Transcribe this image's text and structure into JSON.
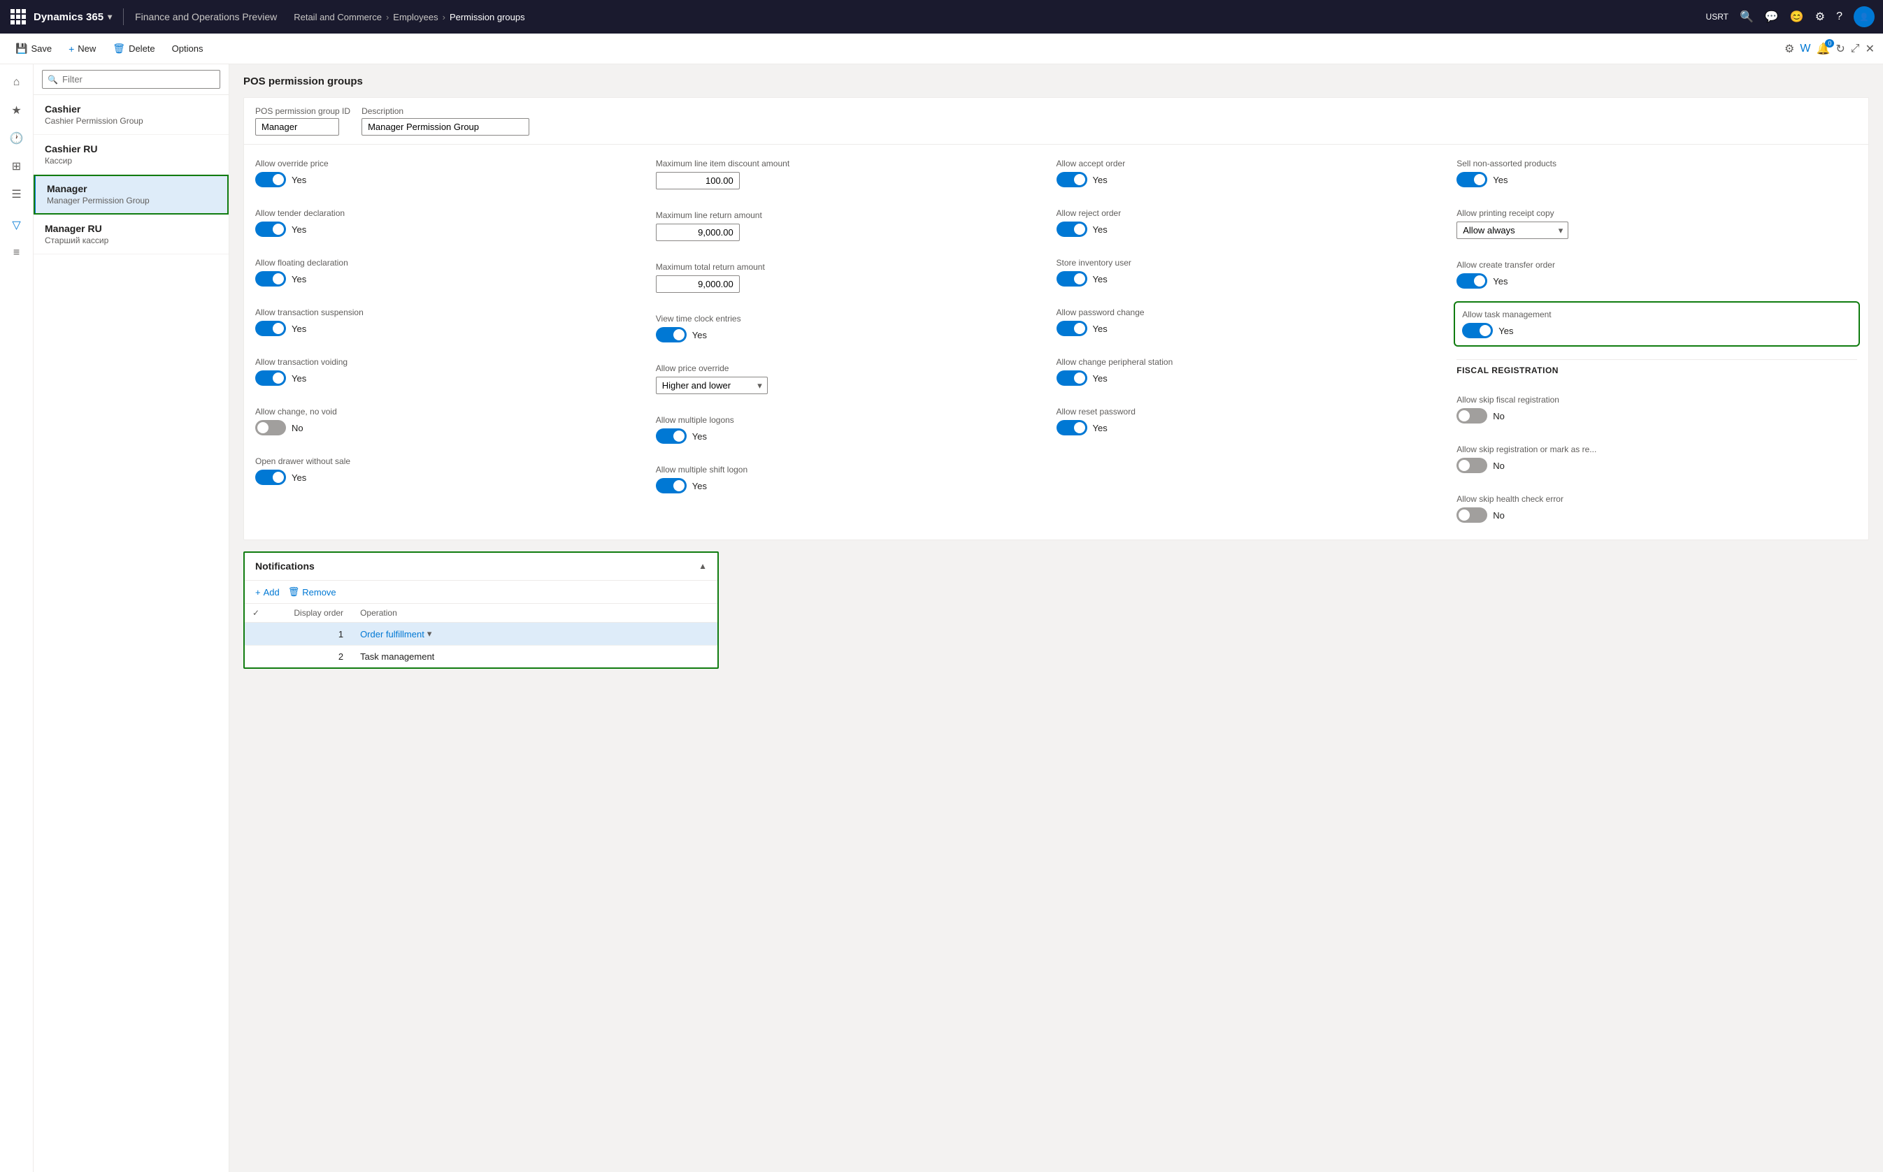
{
  "app": {
    "title": "Dynamics 365",
    "env": "Finance and Operations Preview",
    "breadcrumb": [
      "Retail and Commerce",
      "Employees",
      "Permission groups"
    ],
    "user": "USRT"
  },
  "toolbar": {
    "save": "Save",
    "new": "New",
    "delete": "Delete",
    "options": "Options"
  },
  "list": {
    "filter_placeholder": "Filter",
    "items": [
      {
        "id": "cashier",
        "title": "Cashier",
        "subtitle": "Cashier Permission Group"
      },
      {
        "id": "cashier-ru",
        "title": "Cashier RU",
        "subtitle": "Кассир"
      },
      {
        "id": "manager",
        "title": "Manager",
        "subtitle": "Manager Permission Group",
        "selected": true
      },
      {
        "id": "manager-ru",
        "title": "Manager RU",
        "subtitle": "Старший кассир"
      }
    ]
  },
  "detail": {
    "section_title": "POS permission groups",
    "id_label": "POS permission group ID",
    "id_value": "Manager",
    "desc_label": "Description",
    "desc_value": "Manager Permission Group",
    "permissions": [
      {
        "label": "Allow override price",
        "type": "toggle",
        "state": "on",
        "value": "Yes"
      },
      {
        "label": "Maximum line item discount amount",
        "type": "number",
        "value": "100.00"
      },
      {
        "label": "Allow accept order",
        "type": "toggle",
        "state": "on",
        "value": "Yes"
      },
      {
        "label": "Sell non-assorted products",
        "type": "toggle",
        "state": "on",
        "value": "Yes"
      },
      {
        "label": "Allow tender declaration",
        "type": "toggle",
        "state": "on",
        "value": "Yes"
      },
      {
        "label": "Maximum line return amount",
        "type": "number",
        "value": "9,000.00"
      },
      {
        "label": "Allow accept order",
        "type": "toggle",
        "state": "on",
        "value": "Yes"
      },
      {
        "label": "Sell non-assorted products",
        "type": "toggle",
        "state": "on",
        "value": "Yes"
      },
      {
        "label": "Allow floating declaration",
        "type": "toggle",
        "state": "on",
        "value": "Yes"
      },
      {
        "label": "Maximum total return amount",
        "type": "number",
        "value": "9,000.00"
      },
      {
        "label": "Allow reject order",
        "type": "toggle",
        "state": "on",
        "value": "Yes"
      },
      {
        "label": "Allow printing receipt copy",
        "type": "dropdown",
        "value": "Allow always"
      },
      {
        "label": "Allow transaction suspension",
        "type": "toggle",
        "state": "on",
        "value": "Yes"
      },
      {
        "label": "View time clock entries",
        "type": "toggle",
        "state": "on",
        "value": "Yes"
      },
      {
        "label": "Store inventory user",
        "type": "toggle",
        "state": "on",
        "value": "Yes"
      },
      {
        "label": "Allow create transfer order",
        "type": "toggle",
        "state": "on",
        "value": "Yes"
      },
      {
        "label": "Allow transaction voiding",
        "type": "toggle",
        "state": "on",
        "value": "Yes"
      },
      {
        "label": "Allow price override",
        "type": "dropdown",
        "value": "Higher and lower"
      },
      {
        "label": "Allow password change",
        "type": "toggle",
        "state": "on",
        "value": "Yes"
      },
      {
        "label": "Allow task management",
        "type": "toggle",
        "state": "on",
        "value": "Yes",
        "highlighted": true
      },
      {
        "label": "Allow change, no void",
        "type": "toggle",
        "state": "off",
        "value": "No"
      },
      {
        "label": "Allow multiple logons",
        "type": "toggle",
        "state": "on",
        "value": "Yes"
      },
      {
        "label": "Allow change peripheral station",
        "type": "toggle",
        "state": "on",
        "value": "Yes"
      },
      {
        "label": "",
        "type": "spacer"
      },
      {
        "label": "Open drawer without sale",
        "type": "toggle",
        "state": "on",
        "value": "Yes"
      },
      {
        "label": "Allow multiple shift logon",
        "type": "toggle",
        "state": "on",
        "value": "Yes"
      },
      {
        "label": "Allow reset password",
        "type": "toggle",
        "state": "on",
        "value": "Yes"
      },
      {
        "label": "",
        "type": "spacer"
      }
    ],
    "fiscal_title": "FISCAL REGISTRATION",
    "fiscal_permissions": [
      {
        "label": "Allow skip fiscal registration",
        "type": "toggle",
        "state": "off",
        "value": "No"
      },
      {
        "label": "Allow skip registration or mark as re...",
        "type": "toggle",
        "state": "off",
        "value": "No"
      },
      {
        "label": "Allow skip health check error",
        "type": "toggle",
        "state": "off",
        "value": "No"
      }
    ],
    "notifications": {
      "title": "Notifications",
      "add": "Add",
      "remove": "Remove",
      "col_check": "",
      "col_display_order": "Display order",
      "col_operation": "Operation",
      "rows": [
        {
          "selected": true,
          "display_order": "1",
          "operation": "Order fulfillment",
          "has_dropdown": true
        },
        {
          "selected": false,
          "display_order": "2",
          "operation": "Task management",
          "has_dropdown": false
        }
      ]
    }
  }
}
